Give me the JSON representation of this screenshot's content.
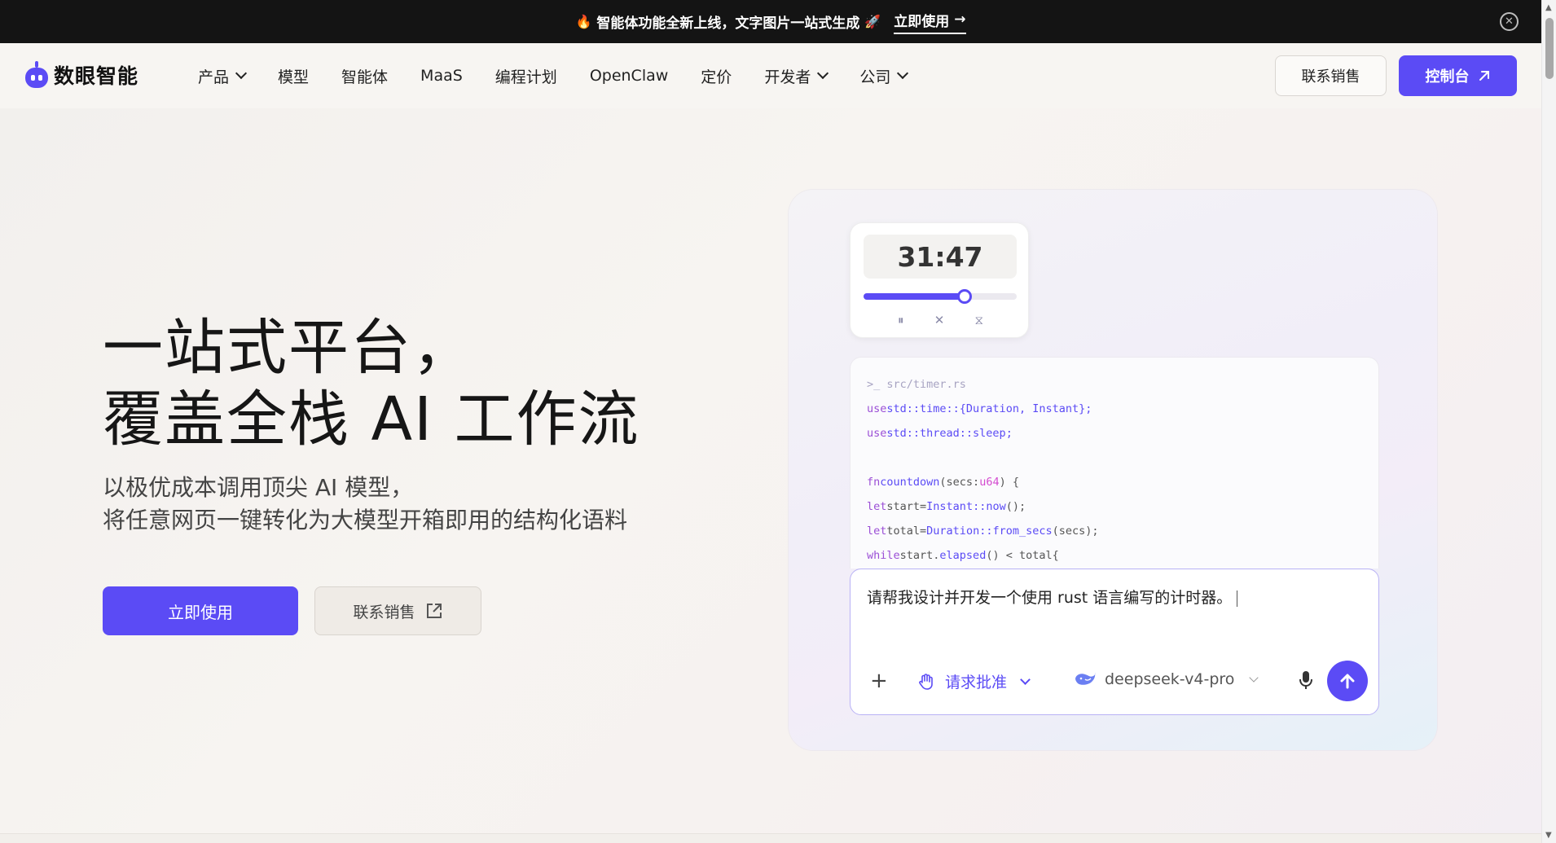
{
  "announcement": {
    "text": "智能体功能全新上线，文字图片一站式生成",
    "cta": "立即使用"
  },
  "nav": {
    "logo_text": "数眼智能",
    "items": [
      {
        "label": "产品",
        "dropdown": true
      },
      {
        "label": "模型",
        "dropdown": false
      },
      {
        "label": "智能体",
        "dropdown": false
      },
      {
        "label": "MaaS",
        "dropdown": false
      },
      {
        "label": "编程计划",
        "dropdown": false
      },
      {
        "label": "OpenClaw",
        "dropdown": false
      },
      {
        "label": "定价",
        "dropdown": false
      },
      {
        "label": "开发者",
        "dropdown": true
      },
      {
        "label": "公司",
        "dropdown": true
      }
    ],
    "sales_label": "联系销售",
    "console_label": "控制台"
  },
  "hero": {
    "title_line1": "一站式平台，",
    "title_line2": "覆盖全栈 AI 工作流",
    "sub_line1": "以极优成本调用顶尖 AI 模型，",
    "sub_line2": "将任意网页一键转化为大模型开箱即用的结构化语料",
    "primary_cta": "立即使用",
    "secondary_cta": "联系销售"
  },
  "demo": {
    "timer": {
      "display": "31:47",
      "progress": 0.66
    },
    "code": {
      "path_line": ">_ src/timer.rs",
      "lines": [
        [
          {
            "t": "use",
            "c": "kw"
          },
          {
            "t": "std::time::{Duration, Instant};",
            "c": "fn"
          }
        ],
        [
          {
            "t": "use",
            "c": "kw"
          },
          {
            "t": "std::thread::sleep;",
            "c": "fn"
          }
        ],
        [],
        [
          {
            "t": "fn",
            "c": "kw"
          },
          {
            "t": "countdown",
            "c": "fn"
          },
          {
            "t": "(secs:",
            "c": "plain"
          },
          {
            "t": "u64",
            "c": "ty"
          },
          {
            "t": ") {",
            "c": "plain"
          }
        ],
        [
          {
            "t": "let",
            "c": "kw"
          },
          {
            "t": "start=",
            "c": "plain"
          },
          {
            "t": "Instant::now",
            "c": "fn"
          },
          {
            "t": "();",
            "c": "plain"
          }
        ],
        [
          {
            "t": "let",
            "c": "kw"
          },
          {
            "t": "total=",
            "c": "plain"
          },
          {
            "t": "Duration::from_secs",
            "c": "fn"
          },
          {
            "t": "(secs);",
            "c": "plain"
          }
        ],
        [
          {
            "t": "while",
            "c": "kw"
          },
          {
            "t": "start.",
            "c": "plain"
          },
          {
            "t": "elapsed",
            "c": "fn"
          },
          {
            "t": "() < total{",
            "c": "plain"
          }
        ]
      ]
    },
    "prompt": {
      "text": "请帮我设计并开发一个使用 rust 语言编写的计时器。",
      "approval_label": "请求批准",
      "model_label": "deepseek-v4-pro"
    }
  },
  "colors": {
    "brand": "#5b4bf5",
    "announcement_bg": "#141414"
  }
}
